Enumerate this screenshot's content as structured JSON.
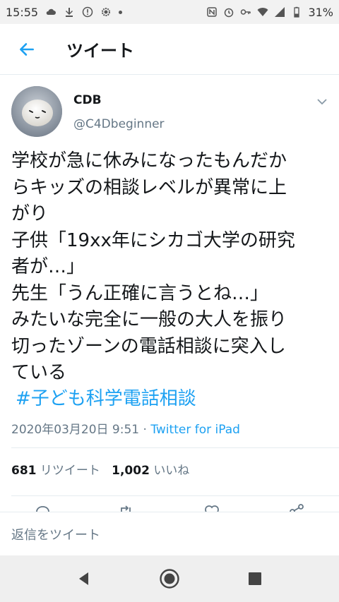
{
  "status_bar": {
    "time": "15:55",
    "battery": "31%",
    "icons": [
      "cloud-icon",
      "download-icon",
      "alert-icon",
      "sun-icon",
      "dot-icon",
      "nfc-icon",
      "alarm-icon",
      "key-icon",
      "wifi-icon",
      "signal-icon",
      "battery-icon"
    ]
  },
  "header": {
    "back_icon": "arrow-left-icon",
    "title": "ツイート"
  },
  "tweet": {
    "display_name": "CDB",
    "handle": "@C4Dbeginner",
    "text": "学校が急に休みになったもんだか\nらキッズの相談レベルが異常に上\nがり\n子供「19xx年にシカゴ大学の研究\n者が…」\n先生「うん正確に言うとね…」\nみたいな完全に一般の大人を振り\n切ったゾーンの電話相談に突入し\nている",
    "hashtag": "#子ども科学電話相談",
    "timestamp": "2020年03月20日 9:51",
    "separator": " · ",
    "client": "Twitter for iPad",
    "retweet_count": "681",
    "retweet_label": "リツイート",
    "like_count": "1,002",
    "like_label": "いいね"
  },
  "actions": [
    "reply-icon",
    "retweet-icon",
    "like-icon",
    "share-icon"
  ],
  "reply_bar": {
    "placeholder": "返信をツイート"
  },
  "nav": [
    "back-triangle-icon",
    "home-circle-icon",
    "recents-square-icon"
  ],
  "colors": {
    "accent": "#1da1f2",
    "text": "#14171a",
    "secondary": "#657786"
  }
}
